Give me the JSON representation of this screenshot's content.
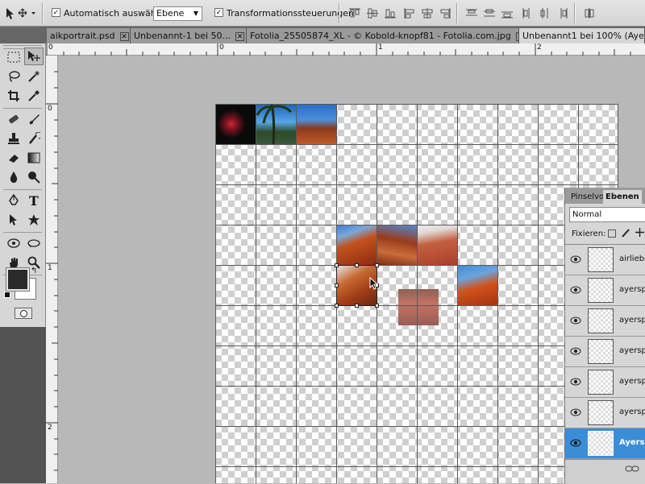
{
  "options_bar": {
    "auto_select_label": "Automatisch auswählen:",
    "auto_select_value": "Ebene",
    "transform_label": "Transformationssteuerungen"
  },
  "tabs": [
    {
      "label": "aikportrait.psd"
    },
    {
      "label": "Unbenannt-1 bei 50..."
    },
    {
      "label": "Fotolia_25505874_XL - © Kobold-knopf81 - Fotolia.com.jpg"
    },
    {
      "label": "Unbenannt1 bei 100% (Aye"
    }
  ],
  "ruler": {
    "h_labels": [
      "0",
      "0",
      "1",
      "2"
    ],
    "v_labels": [
      "0",
      "1",
      "2"
    ]
  },
  "layers_panel": {
    "tab_inactive": "Pinselvo",
    "tab_active": "Ebenen",
    "blend_mode": "Normal",
    "lock_label": "Fixieren:",
    "layers": [
      {
        "name": "airliebe"
      },
      {
        "name": "ayersp"
      },
      {
        "name": "ayersp"
      },
      {
        "name": "ayersp"
      },
      {
        "name": "ayersp"
      },
      {
        "name": "ayersp"
      },
      {
        "name": "Ayers"
      }
    ]
  },
  "colors": {
    "foreground": "#2a2a2a",
    "background": "#ffffff",
    "selection": "#3b8dd8"
  }
}
